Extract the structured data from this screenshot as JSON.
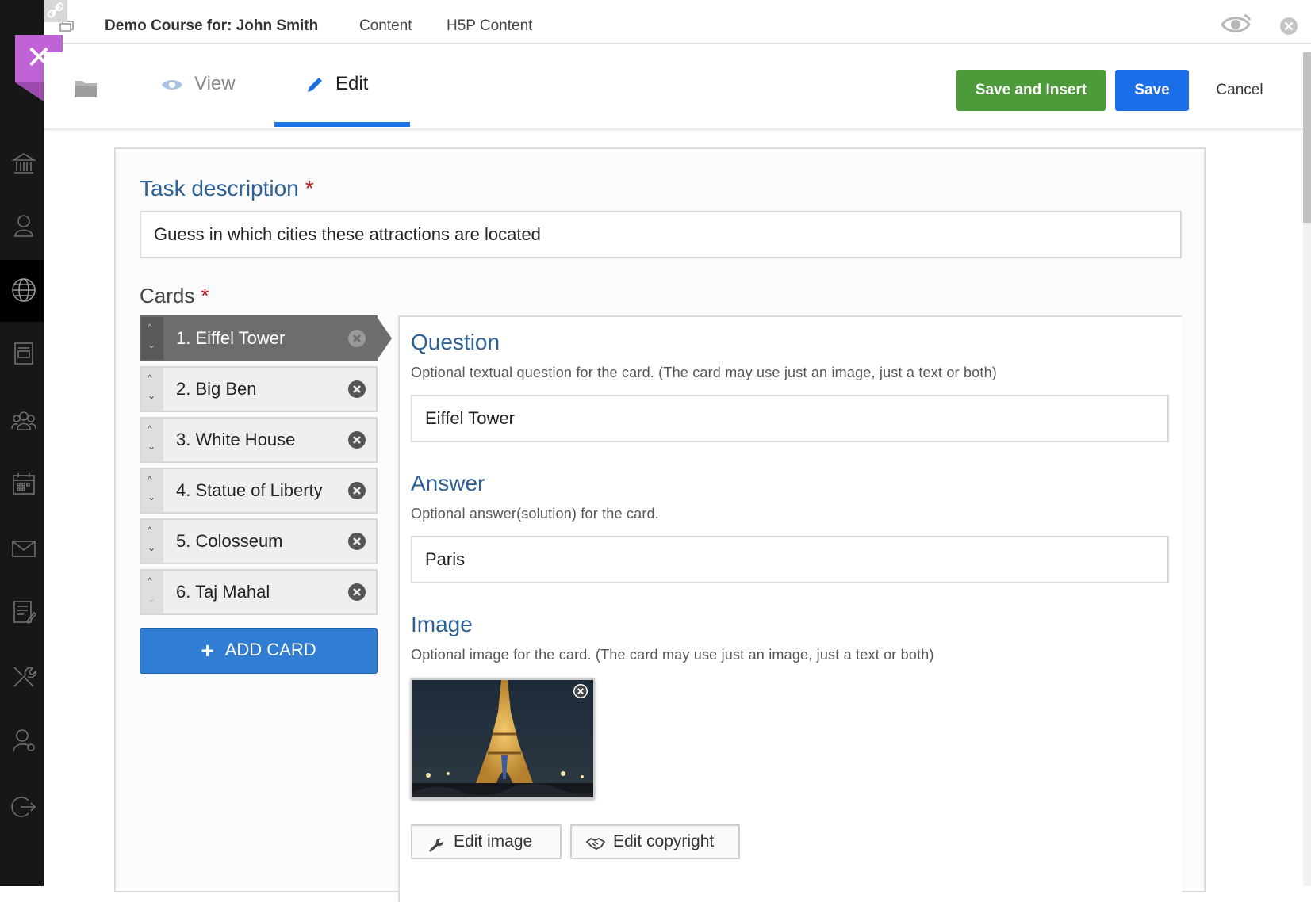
{
  "topbar": {
    "course_title": "Demo Course for: John Smith",
    "links": [
      "Content",
      "H5P Content"
    ]
  },
  "actionbar": {
    "tabs": [
      {
        "label": "View",
        "icon": "eye-icon",
        "active": false
      },
      {
        "label": "Edit",
        "icon": "pencil-icon",
        "active": true
      }
    ],
    "save_insert_label": "Save and Insert",
    "save_label": "Save",
    "cancel_label": "Cancel"
  },
  "editor": {
    "task_description_label": "Task description",
    "task_description_value": "Guess in which cities these attractions are located",
    "cards_label": "Cards",
    "required_mark": "*",
    "cards": [
      {
        "label": "1. Eiffel Tower",
        "active": true
      },
      {
        "label": "2. Big Ben",
        "active": false
      },
      {
        "label": "3. White House",
        "active": false
      },
      {
        "label": "4. Statue of Liberty",
        "active": false
      },
      {
        "label": "5. Colosseum",
        "active": false
      },
      {
        "label": "6. Taj Mahal",
        "active": false
      }
    ],
    "add_card_label": "ADD CARD",
    "question": {
      "label": "Question",
      "description": "Optional textual question for the card. (The card may use just an image, just a text or both)",
      "value": "Eiffel Tower"
    },
    "answer": {
      "label": "Answer",
      "description": "Optional answer(solution) for the card.",
      "value": "Paris"
    },
    "image": {
      "label": "Image",
      "description": "Optional image for the card. (The card may use just an image, just a text or both)",
      "edit_image_label": "Edit image",
      "edit_copyright_label": "Edit copyright"
    }
  },
  "colors": {
    "sidebar": "#171717",
    "accent_purple": "#c063d6",
    "save_insert_green": "#4c9a3a",
    "save_blue": "#1a6fe8",
    "label_blue": "#2d6196",
    "add_card_blue": "#2f7ed4"
  }
}
